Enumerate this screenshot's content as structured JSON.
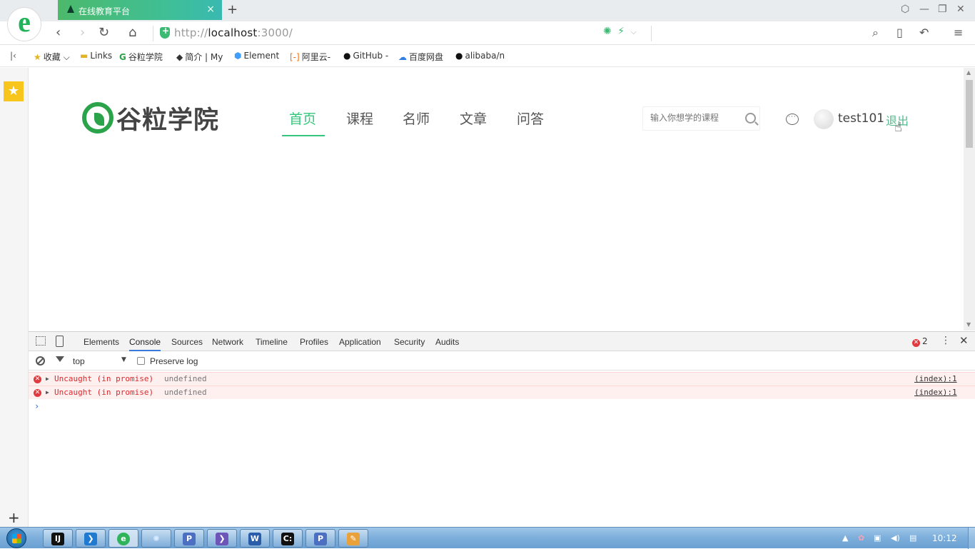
{
  "browser": {
    "logo_letter": "e",
    "tab_title": "在线教育平台",
    "tab_close": "×",
    "new_tab": "+",
    "window_controls": {
      "skin": "⬡",
      "minimize": "—",
      "restore": "❐",
      "close": "✕"
    },
    "url_scheme": "http://",
    "url_host": "localhost",
    "url_port": ":3000/",
    "nav": {
      "back": "‹",
      "forward": "›",
      "reload": "↻",
      "home": "⌂"
    },
    "tools": {
      "search": "⌕",
      "reading": "▯",
      "undo": "↶",
      "menu": "≡"
    }
  },
  "bookmarks": [
    {
      "label": "收藏",
      "icon": "folder-star-icon"
    },
    {
      "label": "Links",
      "icon": "folder-icon"
    },
    {
      "label": "谷粒学院",
      "icon": "g-logo-icon"
    },
    {
      "label": "简介 | My",
      "icon": "cat-icon"
    },
    {
      "label": "Element",
      "icon": "element-icon"
    },
    {
      "label": "阿里云-",
      "icon": "aliyun-icon"
    },
    {
      "label": "GitHub -",
      "icon": "github-icon"
    },
    {
      "label": "百度网盘",
      "icon": "baidu-pan-icon"
    },
    {
      "label": "alibaba/n",
      "icon": "github-icon"
    }
  ],
  "site": {
    "brand": "谷粒学院",
    "nav": [
      "首页",
      "课程",
      "名师",
      "文章",
      "问答"
    ],
    "active_nav": "首页",
    "search_placeholder": "输入你想学的课程",
    "username": "test101",
    "logout": "退出",
    "accent_color": "#34c77b"
  },
  "devtools": {
    "tabs": [
      "Elements",
      "Console",
      "Sources",
      "Network",
      "Timeline",
      "Profiles",
      "Application",
      "Security",
      "Audits"
    ],
    "active_tab": "Console",
    "error_count": "2",
    "context": "top",
    "preserve_log": "Preserve log",
    "logs": [
      {
        "level": "error",
        "message": "Uncaught (in promise)",
        "value": "undefined",
        "source": "(index):1"
      },
      {
        "level": "error",
        "message": "Uncaught (in promise)",
        "value": "undefined",
        "source": "(index):1"
      }
    ],
    "prompt": "›"
  },
  "taskbar": {
    "apps": [
      "intellij-icon",
      "vscode-icon",
      "browser-icon",
      "settings-icon",
      "p-app-icon",
      "arrow-app-icon",
      "word-icon",
      "cmd-icon",
      "p-app-icon",
      "paint-icon"
    ],
    "clock": "10:12"
  }
}
